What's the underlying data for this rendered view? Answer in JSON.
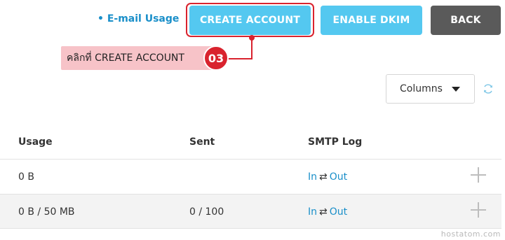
{
  "header": {
    "email_usage_link": "• E-mail Usage",
    "create_account_label": "CREATE ACCOUNT",
    "enable_dkim_label": "ENABLE DKIM",
    "back_label": "BACK"
  },
  "callout": {
    "text": "คลิกที่ CREATE ACCOUNT",
    "step": "03"
  },
  "toolbar": {
    "columns_label": "Columns",
    "refresh_icon": "refresh-icon"
  },
  "table": {
    "headers": {
      "usage": "Usage",
      "sent": "Sent",
      "smtp_log": "SMTP Log"
    },
    "rows": [
      {
        "usage": "0 B",
        "sent": "",
        "log_in": "In",
        "log_swap": "⇄",
        "log_out": "Out"
      },
      {
        "usage": "0 B / 50 MB",
        "sent": "0 / 100",
        "log_in": "In",
        "log_swap": "⇄",
        "log_out": "Out"
      }
    ]
  },
  "watermark": "hostatom.com",
  "colors": {
    "accent": "#54c8f0",
    "back": "#5a5a5a",
    "callout_red": "#d9232e",
    "link": "#1a8fc9"
  }
}
